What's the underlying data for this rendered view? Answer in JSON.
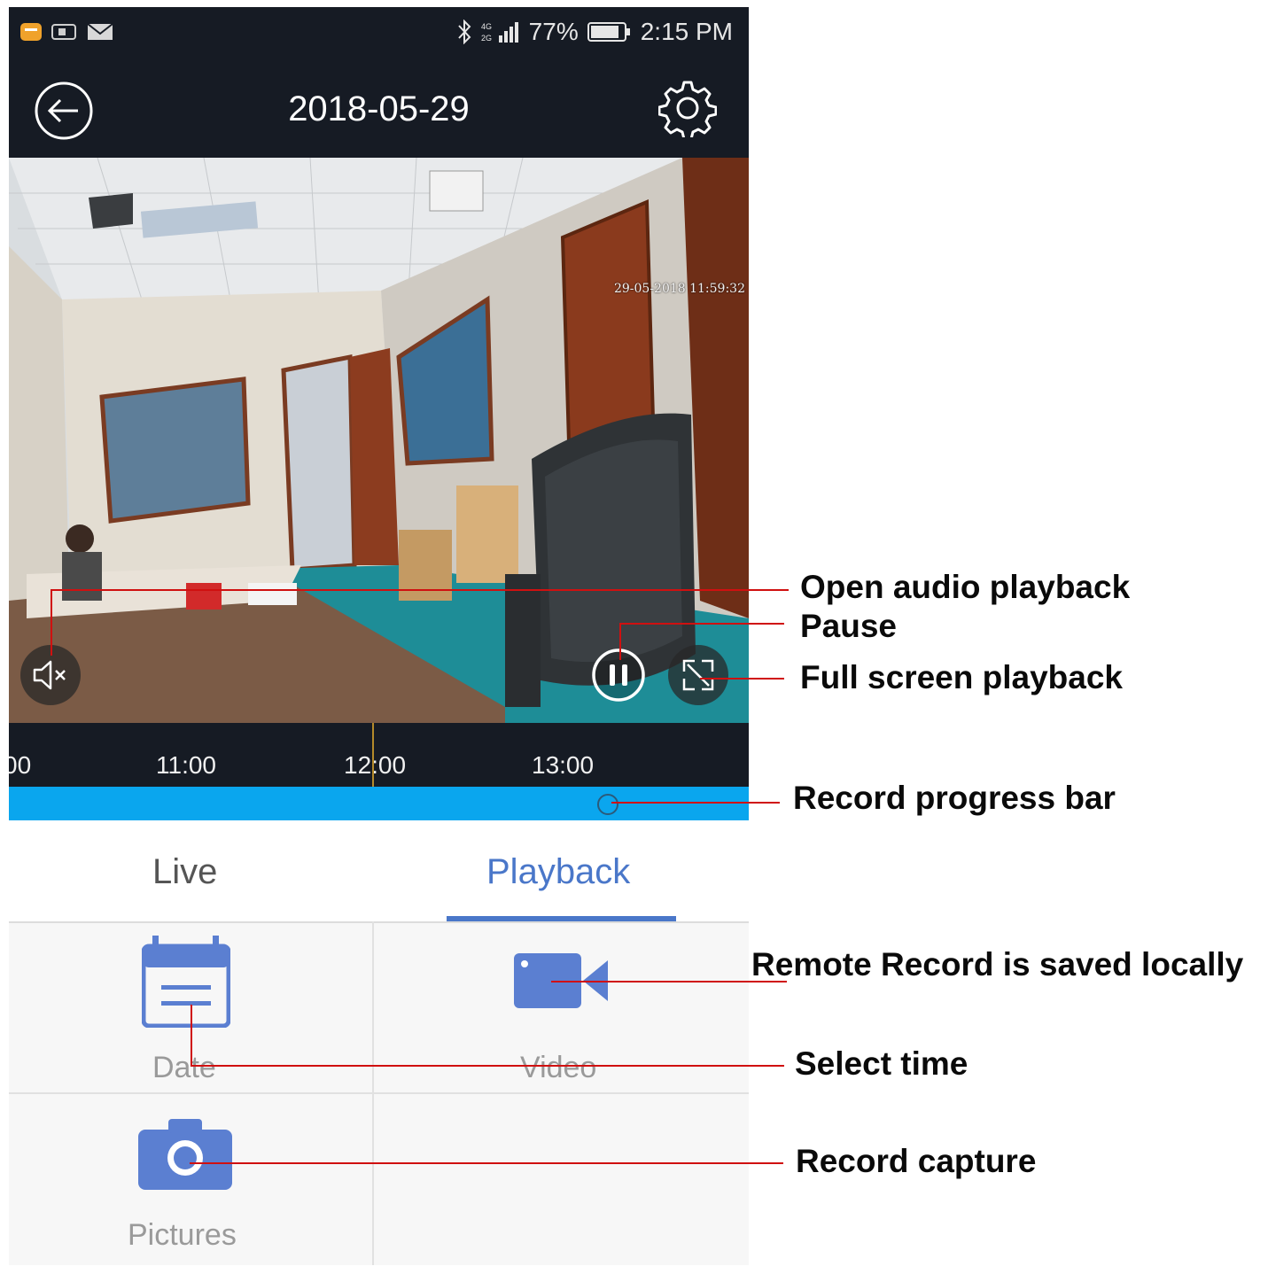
{
  "status_bar": {
    "battery_percent": "77%",
    "time": "2:15 PM",
    "icons": [
      "message-icon",
      "sim-icon",
      "mail-icon",
      "bluetooth-icon",
      "signal-icon",
      "battery-icon"
    ]
  },
  "app_bar": {
    "title": "2018-05-29",
    "icons": [
      "back-arrow-icon",
      "gear-icon"
    ]
  },
  "video": {
    "overlay_timestamp": "29-05-2018 11:59:32",
    "controls": [
      "mute-icon",
      "pause-icon",
      "fullscreen-icon"
    ]
  },
  "timeline": {
    "ticks": [
      "00",
      "11:00",
      "12:00",
      "13:00"
    ],
    "progress": 0.81
  },
  "tabs": {
    "live": "Live",
    "playback": "Playback",
    "active": "playback",
    "active_color": "#4a77c9",
    "inactive_color": "#555555"
  },
  "grid": {
    "date_label": "Date",
    "video_label": "Video",
    "pictures_label": "Pictures",
    "icon_color": "#5b7fd1"
  },
  "annotations": {
    "audio": "Open audio playback",
    "pause": "Pause",
    "fullscreen": "Full screen playback",
    "progress": "Record progress bar",
    "remote": "Remote Record is saved locally",
    "select_time": "Select  time",
    "capture": "Record capture",
    "line_color": "#d01010"
  }
}
